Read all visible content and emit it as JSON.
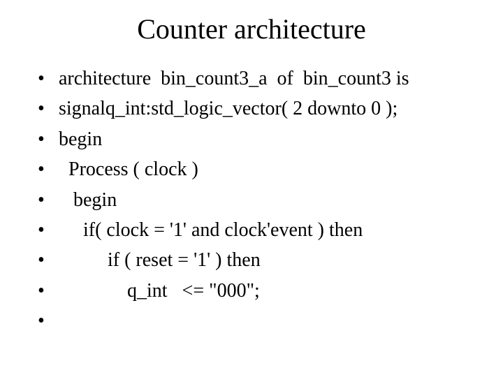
{
  "title": "Counter architecture",
  "bullets": [
    "architecture  bin_count3_a  of  bin_count3 is",
    "signalq_int:std_logic_vector( 2 downto 0 );",
    "begin",
    "  Process ( clock )",
    "   begin",
    "     if( clock = '1' and clock'event ) then",
    "          if ( reset = '1' ) then",
    "              q_int   <= \"000\";",
    ""
  ]
}
